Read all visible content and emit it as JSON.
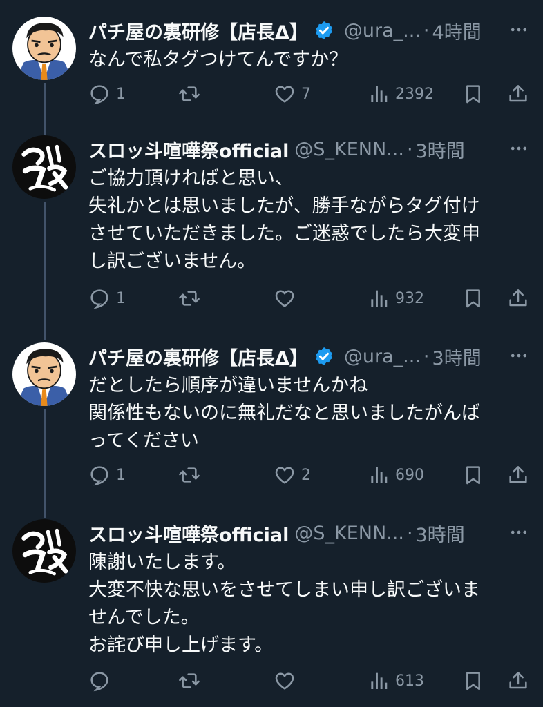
{
  "tweets": [
    {
      "avatar": "manager-cartoon-avatar",
      "name": "パチ屋の裏研修【店長Δ】",
      "verified": true,
      "handle": "@ura_...",
      "dot": "·",
      "time": "4時間",
      "text": "なんで私タグつけてんですか？",
      "replies": "1",
      "retweets": "",
      "likes": "7",
      "views": "2392"
    },
    {
      "avatar": "calligraphy-logo-avatar",
      "name": "スロッ斗喧嘩祭official",
      "verified": false,
      "handle": "@S_KENN...",
      "dot": "·",
      "time": "3時間",
      "text": "ご協力頂ければと思い、\n失礼かとは思いましたが、勝手ながらタグ付け\nさせていただきました。ご迷惑でしたら大変申\nし訳ございません。",
      "replies": "1",
      "retweets": "",
      "likes": "",
      "views": "932"
    },
    {
      "avatar": "manager-cartoon-avatar",
      "name": "パチ屋の裏研修【店長Δ】",
      "verified": true,
      "handle": "@ura_...",
      "dot": "·",
      "time": "3時間",
      "text": "だとしたら順序が違いませんかね\n関係性もないのに無礼だなと思いましたがんば\nってください",
      "replies": "1",
      "retweets": "",
      "likes": "2",
      "views": "690"
    },
    {
      "avatar": "calligraphy-logo-avatar",
      "name": "スロッ斗喧嘩祭official",
      "verified": false,
      "handle": "@S_KENN...",
      "dot": "·",
      "time": "3時間",
      "text": "陳謝いたします。\n大変不快な思いをさせてしまい申し訳ございま\nせんでした。\nお詫び申し上げます。",
      "replies": "",
      "retweets": "",
      "likes": "",
      "views": "613"
    }
  ],
  "colors": {
    "background": "#15202b",
    "text": "#f7f9f9",
    "muted": "#8b98a5",
    "verified": "#1d9bf0",
    "thread_line": "#42536a"
  },
  "icons": {
    "reply": "reply-icon",
    "retweet": "retweet-icon",
    "like": "heart-icon",
    "views": "views-icon",
    "bookmark": "bookmark-icon",
    "share": "share-icon",
    "more": "more-icon",
    "verified": "verified-badge-icon"
  }
}
